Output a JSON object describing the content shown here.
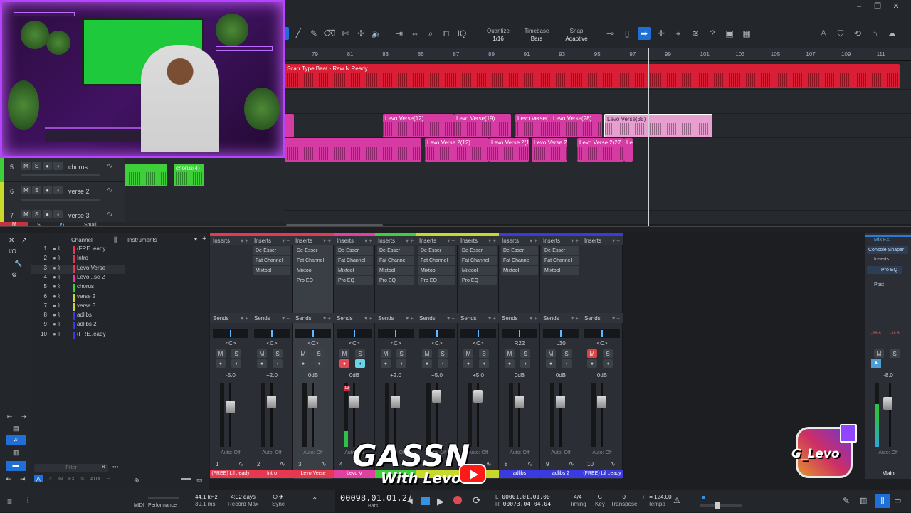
{
  "toolbar": {
    "quantize": {
      "label": "Quantize",
      "value": "1/16"
    },
    "timebase": {
      "label": "Timebase",
      "value": "Bars"
    },
    "snap": {
      "label": "Snap",
      "value": "Adaptive"
    },
    "iq": "IQ"
  },
  "ruler": {
    "bars": [
      "79",
      "81",
      "83",
      "85",
      "87",
      "89",
      "91",
      "93",
      "95",
      "97",
      "99",
      "101",
      "103",
      "105",
      "107",
      "109",
      "111"
    ]
  },
  "clips": {
    "main": "Scarr Type Beat - Raw N Ready",
    "levo": [
      "Levo Verse(12)",
      "Levo Verse(19)",
      "Levo Verse(",
      "Levo Verse(28)",
      "Levo Verse(35)"
    ],
    "levo2": [
      "Levo Verse 2(12)",
      "Levo Verse 2(1",
      "Levo Verse 2",
      "Levo Verse 2(27",
      "Le"
    ],
    "chorus": "chorus(4)"
  },
  "tracks": [
    {
      "num": "5",
      "name": "chorus",
      "color": "#3ecf3a"
    },
    {
      "num": "6",
      "name": "verse 2",
      "color": "#c7d92b"
    },
    {
      "num": "7",
      "name": "verse 3",
      "color": "#c7d92b"
    }
  ],
  "track_buttons": {
    "m": "M",
    "s": "S"
  },
  "arrange_footer": {
    "m": "M",
    "s": "S",
    "size": "Small"
  },
  "channel_panel": {
    "io": "I/O",
    "header": "Channel",
    "instruments": "Instruments",
    "filter": "Filter",
    "channels": [
      {
        "n": "1",
        "name": "(FRE..eady",
        "color": "#e8384f"
      },
      {
        "n": "2",
        "name": "Intro",
        "color": "#e8384f"
      },
      {
        "n": "3",
        "name": "Levo Verse",
        "color": "#e8384f"
      },
      {
        "n": "4",
        "name": "Levo...se 2",
        "color": "#e040a0"
      },
      {
        "n": "5",
        "name": "chorus",
        "color": "#3ecf3a"
      },
      {
        "n": "6",
        "name": "verse 2",
        "color": "#c7d92b"
      },
      {
        "n": "7",
        "name": "verse 3",
        "color": "#c7d92b"
      },
      {
        "n": "8",
        "name": "adlibs",
        "color": "#3a3adf"
      },
      {
        "n": "9",
        "name": "adlibs 2",
        "color": "#3a3adf"
      },
      {
        "n": "10",
        "name": "(FRE..eady",
        "color": "#3a3adf"
      }
    ],
    "tabs": [
      "IN",
      "FX",
      "AUX"
    ]
  },
  "mixer": {
    "inserts_label": "Inserts",
    "sends_label": "Sends",
    "auto_label": "Auto: Off",
    "strips": [
      {
        "num": "1",
        "name": "(FREE) Lil ..eady",
        "pan": "<C>",
        "gain": "-5.0",
        "color": "#e8384f",
        "inserts": []
      },
      {
        "num": "2",
        "name": "Intro",
        "pan": "<C>",
        "gain": "+2.0",
        "color": "#e8384f",
        "inserts": [
          "De-Esser",
          "Fat Channel",
          "Mixtool"
        ]
      },
      {
        "num": "3",
        "name": "Levo Verse",
        "pan": "<C>",
        "gain": "0dB",
        "color": "#e8384f",
        "inserts": [
          "De-Esser",
          "Fat Channel",
          "Mixtool",
          "Pro EQ"
        ]
      },
      {
        "num": "4",
        "name": "Levo V",
        "pan": "<C>",
        "gain": "0dB",
        "color": "#e040a0",
        "inserts": [
          "De-Esser",
          "Fat Channel",
          "Mixtool",
          "Pro EQ"
        ],
        "clip": "13"
      },
      {
        "num": "5",
        "name": "",
        "pan": "<C>",
        "gain": "+2.0",
        "color": "#3ecf3a",
        "inserts": [
          "De-Esser",
          "Fat Channel",
          "Mixtool",
          "Pro EQ"
        ]
      },
      {
        "num": "6",
        "name": "",
        "pan": "<C>",
        "gain": "+5.0",
        "color": "#c7d92b",
        "inserts": [
          "De-Esser",
          "Fat Channel",
          "Mixtool",
          "Pro EQ"
        ]
      },
      {
        "num": "7",
        "name": "",
        "pan": "<C>",
        "gain": "+5.0",
        "color": "#c7d92b",
        "inserts": [
          "De-Esser",
          "Fat Channel",
          "Mixtool",
          "Pro EQ"
        ]
      },
      {
        "num": "8",
        "name": "adlibs",
        "pan": "R22",
        "gain": "0dB",
        "color": "#3a3adf",
        "inserts": [
          "De-Esser",
          "Fat Channel",
          "Mixtool"
        ]
      },
      {
        "num": "9",
        "name": "adlibs 2",
        "pan": "L30",
        "gain": "0dB",
        "color": "#3a3adf",
        "inserts": [
          "De-Esser",
          "Fat Channel",
          "Mixtool"
        ]
      },
      {
        "num": "10",
        "name": "(FREE) Lil ..eady",
        "pan": "<C>",
        "gain": "0dB",
        "color": "#3a3adf",
        "inserts": []
      }
    ],
    "buttons": {
      "m": "M",
      "s": "S"
    }
  },
  "main": {
    "mixfx": "Mix FX",
    "console": "Console Shaper",
    "inserts": "Inserts",
    "proeq": "Pro EQ",
    "post": "Post",
    "peak_l": "-38.6",
    "peak_r": "-38.6",
    "gain": "-8.0",
    "auto": "Auto: Off",
    "name": "Main"
  },
  "transport": {
    "midi": "MIDI",
    "performance": "Performance",
    "sample_rate": "44.1 kHz",
    "latency": "39.1 ms",
    "record_max_val": "4:02 days",
    "record_max": "Record Max",
    "sync": "Sync",
    "position": "00098.01.01.27",
    "bars": "Bars",
    "loop_l": "00001.01.01.00",
    "loop_r": "00073.04.04.04",
    "l": "L",
    "r": "R",
    "timing_val": "4/4",
    "timing": "Timing",
    "key_val": "G",
    "key": "Key",
    "transpose_val": "0",
    "transpose": "Transpose",
    "tempo_val": "124.00",
    "tempo": "Tempo"
  },
  "overlay": {
    "gassn": "GASSN",
    "with": "With Levo",
    "ig": "G_Levo"
  }
}
